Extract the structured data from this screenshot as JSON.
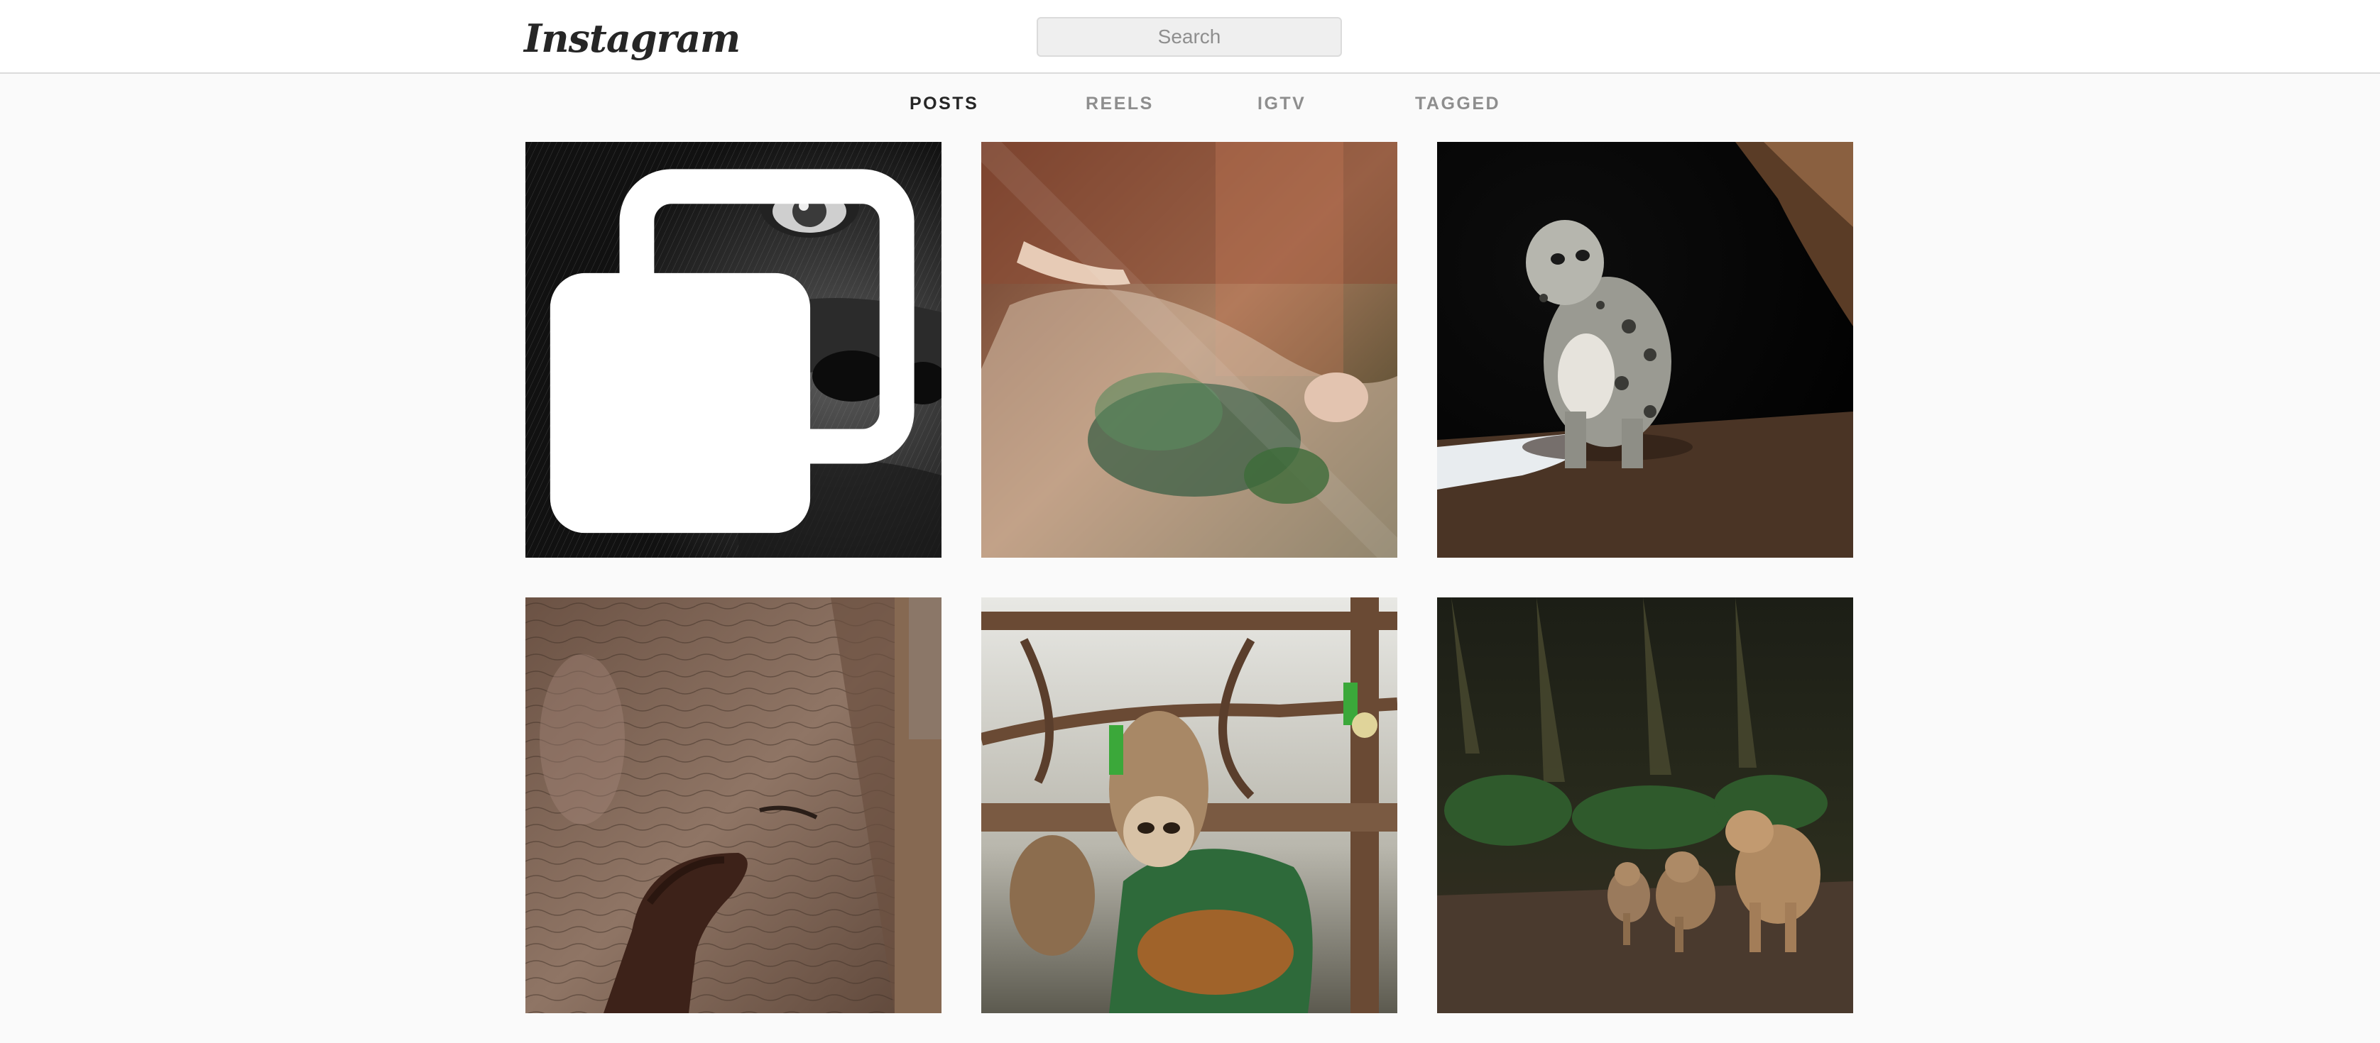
{
  "header": {
    "logo_text": "Instagram",
    "search_placeholder": "Search"
  },
  "tabs": [
    {
      "label": "POSTS",
      "active": true
    },
    {
      "label": "REELS",
      "active": false
    },
    {
      "label": "IGTV",
      "active": false
    },
    {
      "label": "TAGGED",
      "active": false
    }
  ],
  "posts": [
    {
      "subject": "gorilla close-up",
      "multi_photo": true
    },
    {
      "subject": "woman reflection through window",
      "multi_photo": false
    },
    {
      "subject": "snow leopard in cave",
      "multi_photo": false
    },
    {
      "subject": "elephant with hand",
      "multi_photo": false
    },
    {
      "subject": "sloths hanging",
      "multi_photo": false
    },
    {
      "subject": "panther family at night",
      "multi_photo": false
    }
  ],
  "colors": {
    "background": "#fafafa",
    "text_primary": "#262626",
    "text_secondary": "#8e8e8e",
    "border": "#dbdbdb"
  }
}
